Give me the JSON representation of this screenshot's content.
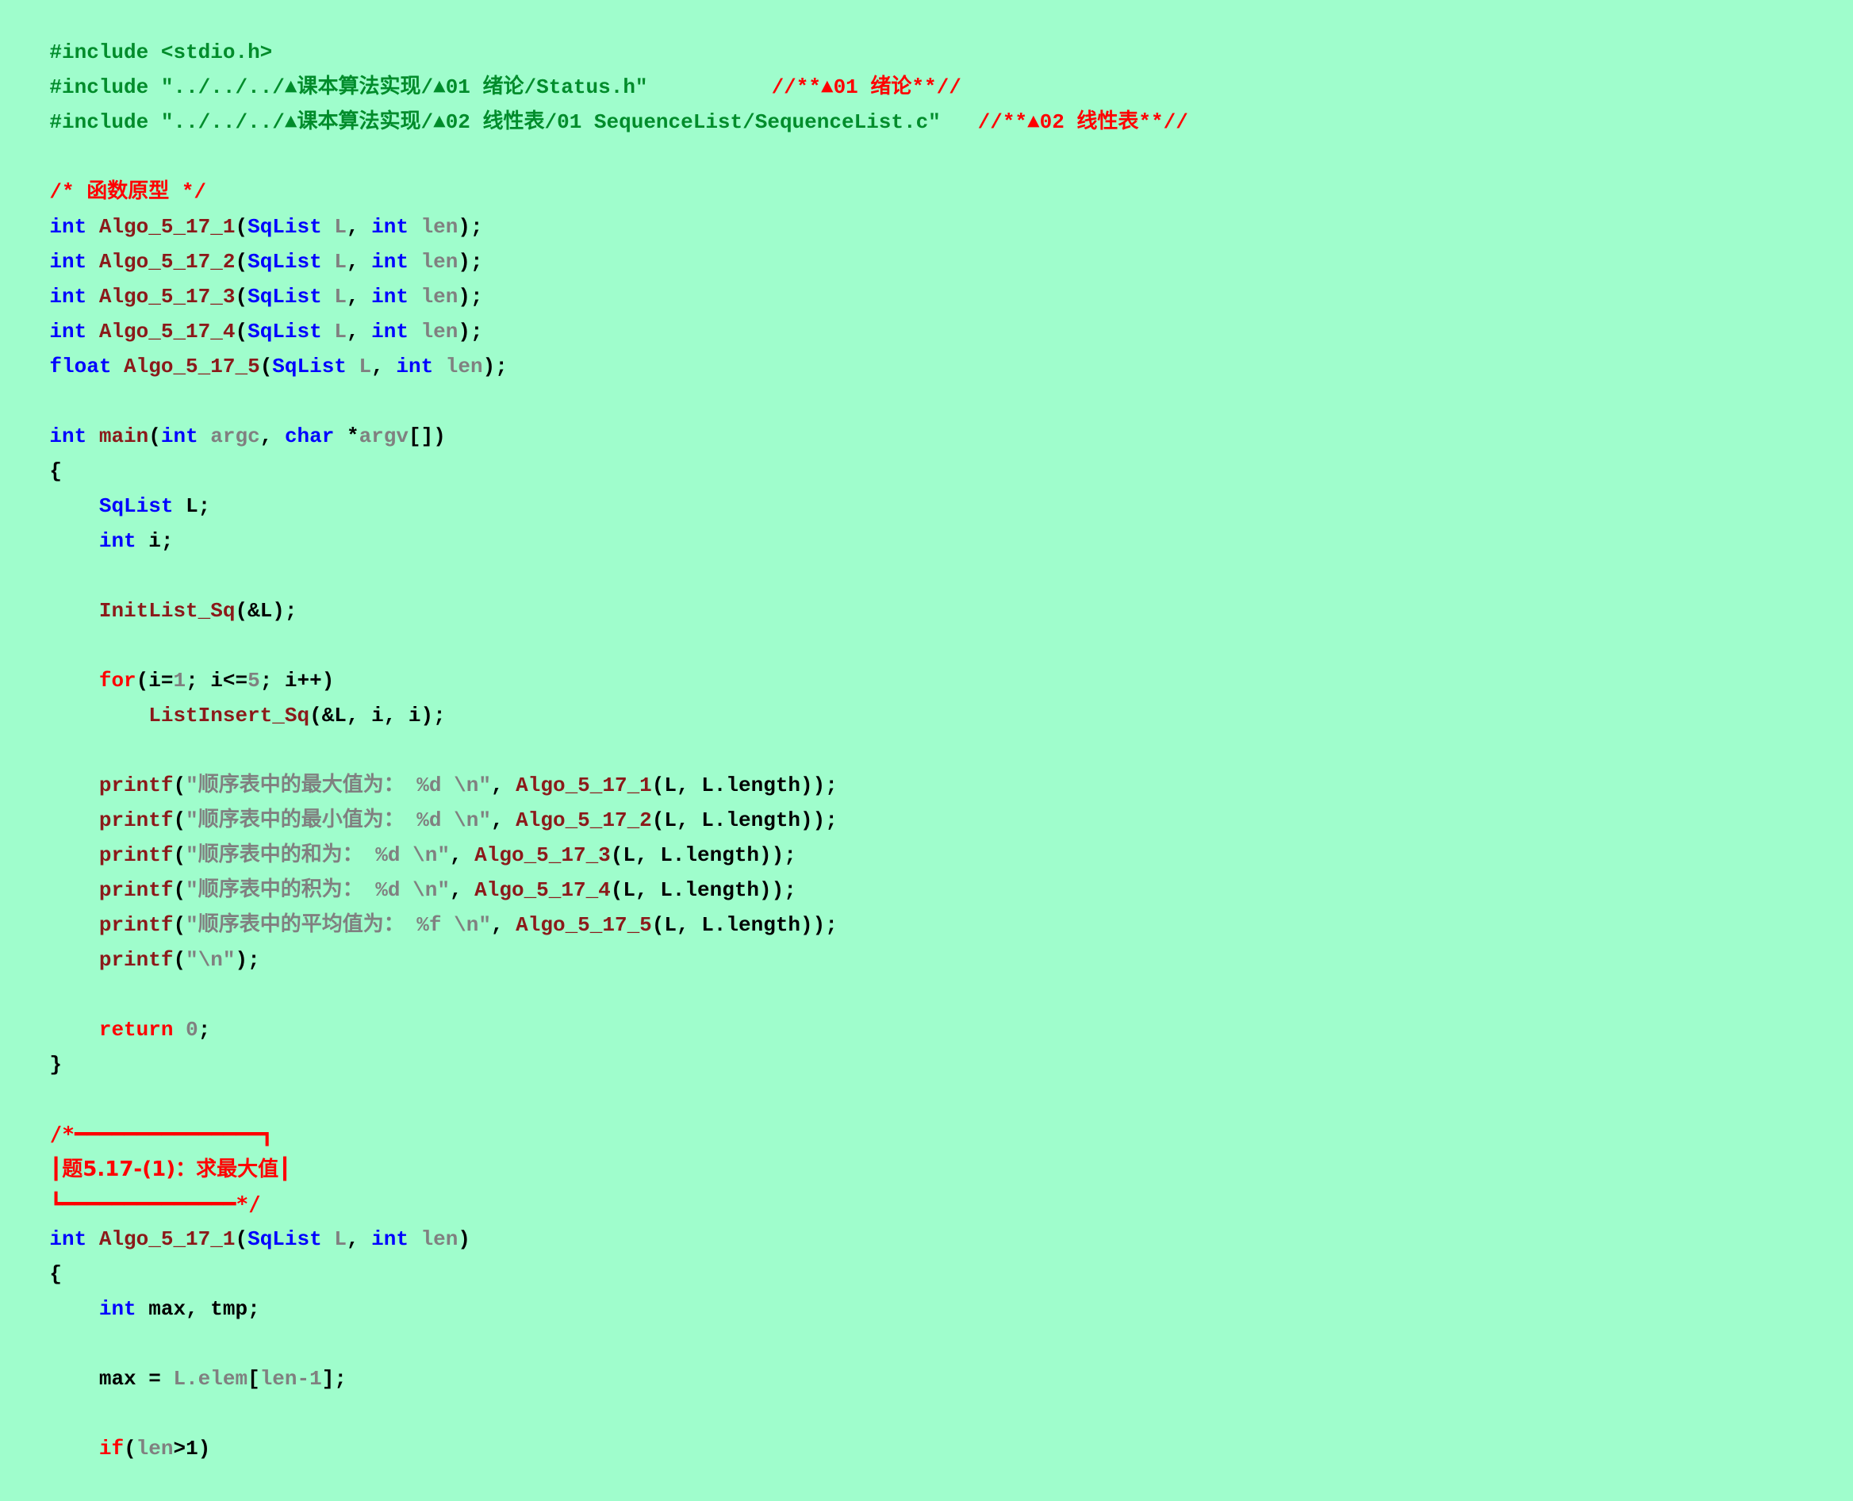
{
  "app": {
    "type": "code-editor",
    "language": "C",
    "background_color": "#9ffdcc",
    "colors": {
      "preprocessor": "#008c2b",
      "comment_red": "#ff0000",
      "type_keyword": "#0000ff",
      "control_keyword": "#ff0000",
      "function_name": "#8b1a1a",
      "identifier_grey": "#808080",
      "plain_black": "#000000"
    }
  },
  "code": {
    "includes": [
      {
        "directive": "#include",
        "target": "<stdio.h>",
        "trailing_comment": ""
      },
      {
        "directive": "#include",
        "target": "\"../../../▲课本算法实现/▲01 绪论/Status.h\"",
        "trailing_comment": "//**▲01 绪论**//"
      },
      {
        "directive": "#include",
        "target": "\"../../../▲课本算法实现/▲02 线性表/01 SequenceList/SequenceList.c\"",
        "trailing_comment": "//**▲02 线性表**//"
      }
    ],
    "prototype_header": "/* 函数原型 */",
    "prototypes": [
      {
        "ret": "int",
        "name": "Algo_5_17_1",
        "p1t": "SqList",
        "p1n": "L",
        "p2t": "int",
        "p2n": "len"
      },
      {
        "ret": "int",
        "name": "Algo_5_17_2",
        "p1t": "SqList",
        "p1n": "L",
        "p2t": "int",
        "p2n": "len"
      },
      {
        "ret": "int",
        "name": "Algo_5_17_3",
        "p1t": "SqList",
        "p1n": "L",
        "p2t": "int",
        "p2n": "len"
      },
      {
        "ret": "int",
        "name": "Algo_5_17_4",
        "p1t": "SqList",
        "p1n": "L",
        "p2t": "int",
        "p2n": "len"
      },
      {
        "ret": "float",
        "name": "Algo_5_17_5",
        "p1t": "SqList",
        "p1n": "L",
        "p2t": "int",
        "p2n": "len"
      }
    ],
    "main": {
      "ret": "int",
      "name": "main",
      "arg1_type": "int",
      "arg1_name": "argc",
      "arg2_type": "char",
      "arg2_name": "argv",
      "open_brace": "{",
      "close_brace": "}",
      "decl_sqlist_type": "SqList",
      "decl_sqlist_name": "L;",
      "decl_int_type": "int",
      "decl_int_name": "i;",
      "init_call": "InitList_Sq",
      "init_args": "(&L);",
      "for_kw": "for",
      "for_init_var": "(i=",
      "for_init_val": "1",
      "for_cond": "; i<=",
      "for_cond_val": "5",
      "for_incr": "; i++)",
      "insert_call": "ListInsert_Sq",
      "insert_args": "(&L, i, i);",
      "printfs": [
        {
          "fn": "printf",
          "text": "顺序表中的最大值为：",
          "fmt": " %d \\n",
          "call": "Algo_5_17_1",
          "args": "(L, L.length));"
        },
        {
          "fn": "printf",
          "text": "顺序表中的最小值为：",
          "fmt": " %d \\n",
          "call": "Algo_5_17_2",
          "args": "(L, L.length));"
        },
        {
          "fn": "printf",
          "text": "顺序表中的和为：",
          "fmt": " %d \\n",
          "call": "Algo_5_17_3",
          "args": "(L, L.length));"
        },
        {
          "fn": "printf",
          "text": "顺序表中的积为：",
          "fmt": " %d \\n",
          "call": "Algo_5_17_4",
          "args": "(L, L.length));"
        },
        {
          "fn": "printf",
          "text": "顺序表中的平均值为：",
          "fmt": " %f \\n",
          "call": "Algo_5_17_5",
          "args": "(L, L.length));"
        }
      ],
      "printf_newline_fn": "printf",
      "printf_newline_arg": "\\n",
      "return_kw": "return",
      "return_val": "0"
    },
    "boxed_comment": {
      "open": "/*",
      "close": "*/",
      "title": "题5.17-(1)：求最大值",
      "top_rule_width_chars": 16,
      "bottom_rule_width_chars": 16
    },
    "algo1": {
      "ret": "int",
      "name": "Algo_5_17_1",
      "p1t": "SqList",
      "p1n": "L",
      "p2t": "int",
      "p2n": "len",
      "open_brace": "{",
      "decl_type": "int",
      "decl_names": "max, tmp;",
      "assign_lhs": "max = ",
      "assign_obj": "L.elem",
      "assign_idx_open": "[",
      "assign_idx": "len-1",
      "assign_idx_close": "];",
      "if_kw": "if",
      "if_open": "(",
      "if_var": "len",
      "if_rest": ">1)"
    }
  }
}
